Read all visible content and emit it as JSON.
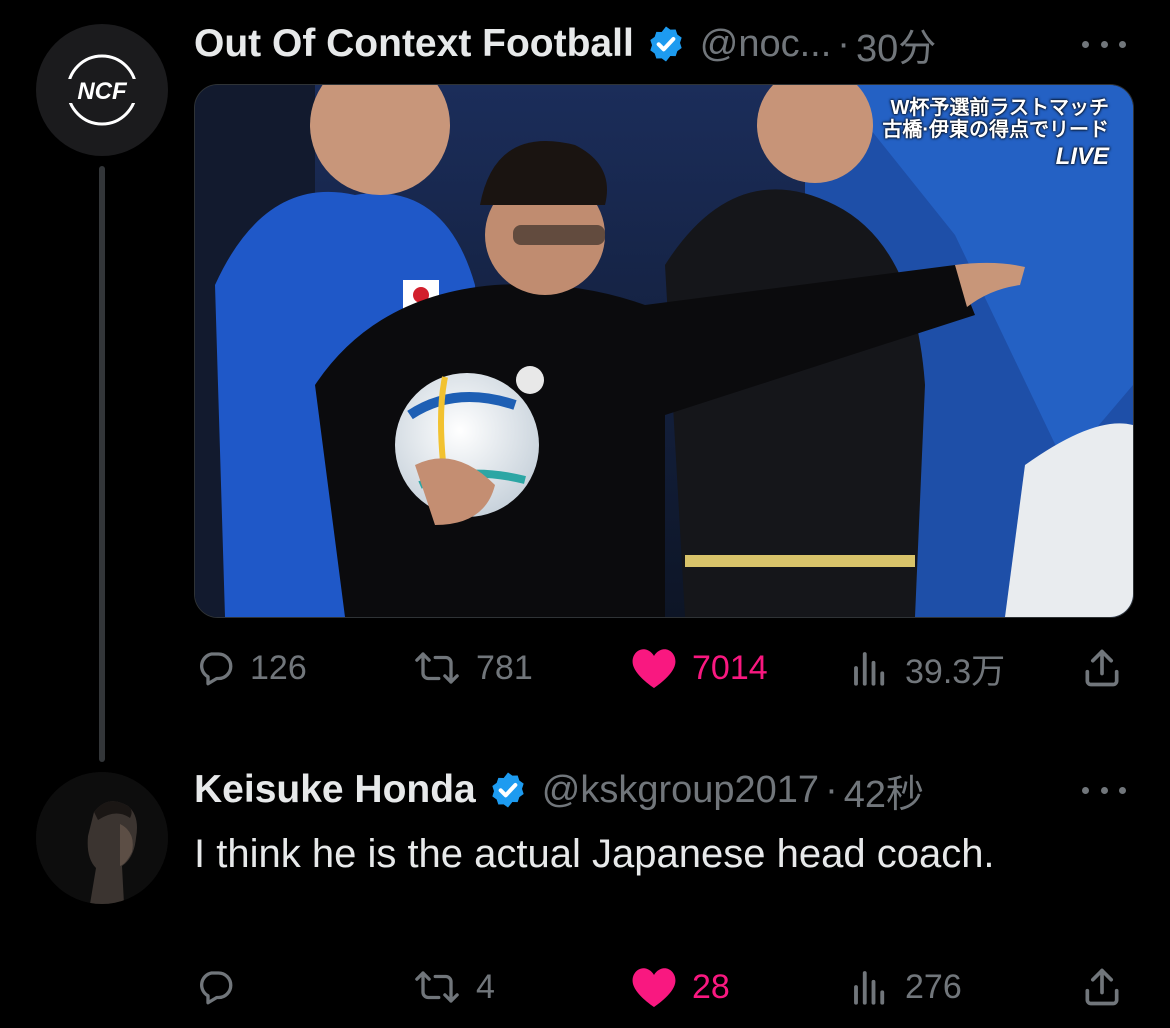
{
  "tweet": {
    "author_name": "Out Of Context Football",
    "handle": "@noc...",
    "dot": "·",
    "time": "30分",
    "avatar_text": "NCF",
    "media_overlay": {
      "line1": "W杯予選前ラストマッチ",
      "line2": "古橋·伊東の得点でリード",
      "live": "LIVE"
    },
    "stats": {
      "replies": "126",
      "retweets": "781",
      "likes": "7014",
      "views": "39.3万"
    }
  },
  "reply": {
    "author_name": "Keisuke Honda",
    "handle": "@kskgroup2017",
    "dot": "·",
    "time": "42秒",
    "text": "I think he is the actual Japanese head coach.",
    "stats": {
      "replies": "",
      "retweets": "4",
      "likes": "28",
      "views": "276"
    }
  },
  "colors": {
    "background": "#000000",
    "text": "#e7e9ea",
    "secondary_text": "#71767b",
    "like_pink": "#f91880",
    "verified_blue": "#1d9bf0"
  },
  "icons": [
    "verified-badge-icon",
    "more-icon",
    "reply-icon",
    "retweet-icon",
    "like-icon",
    "views-icon",
    "share-icon"
  ]
}
